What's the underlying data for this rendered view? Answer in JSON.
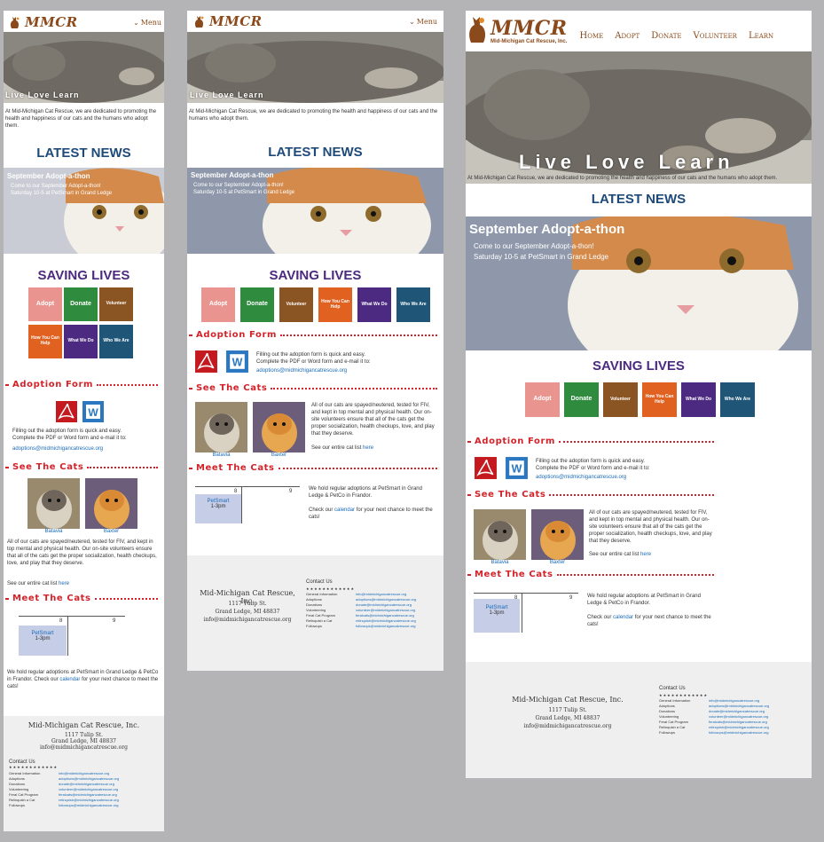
{
  "brand": {
    "logo_text": "MMCR",
    "logo_subtitle": "Mid-Michigan Cat Rescue, Inc.",
    "brown": "#8b4a1b"
  },
  "menu_label": "Menu",
  "nav": [
    "Home",
    "Adopt",
    "Donate",
    "Volunteer",
    "Learn"
  ],
  "hero_tagline": "Live Love Learn",
  "intro": "At Mid-Michigan Cat Rescue, we are dedicated to promoting the health and happiness of our cats and the humans who adopt them.",
  "latest_news": {
    "heading": "LATEST NEWS",
    "title": "September Adopt-a-thon",
    "body_line1": "Come to our September Adopt-a-thon!",
    "body_line2": "Saturday 10-5 at PetSmart in Grand Ledge"
  },
  "saving_lives": {
    "heading": "SAVING LIVES",
    "tiles": [
      {
        "label": "Adopt",
        "color": "#ea9490"
      },
      {
        "label": "Donate",
        "color": "#2f8b3e"
      },
      {
        "label": "Volunteer",
        "color": "#8b5423"
      },
      {
        "label": "How You Can Help",
        "color": "#e06120"
      },
      {
        "label": "What We Do",
        "color": "#4d2a82"
      },
      {
        "label": "Who We Are",
        "color": "#1f5678"
      }
    ]
  },
  "adoption_form": {
    "heading": "Adoption Form",
    "text_line1": "Filling out the adoption form is quick and easy.",
    "text_line2": "Complete the PDF or Word form and e-mail it to:",
    "email": "adoptions@midmichigancatrescue.org"
  },
  "see_cats": {
    "heading": "See The Cats",
    "cats": [
      {
        "name": "Batavia",
        "icon": "tabby-kitten-photo"
      },
      {
        "name": "Baxter",
        "icon": "orange-kitten-photo"
      }
    ],
    "text": "All of our cats are spayed/neutered, tested for FIV, and kept in top mental and physical health. Our on-site volunteers ensure that all of the cats get the proper socialization, health checkups, love, and play that they deserve.",
    "list_prefix": "See our entire cat list",
    "list_link": "here"
  },
  "meet_cats": {
    "heading": "Meet The Cats",
    "calendar": {
      "day1": "8",
      "day2": "9",
      "event": "PetSmart",
      "event_time": "1-3pm"
    },
    "text": "We hold regular adoptions at PetSmart in Grand Ledge & PetCo in Frandor.",
    "check_prefix": "Check our",
    "check_link": "calendar",
    "check_suffix": "for your next chance to meet the cats!"
  },
  "footer": {
    "org": "Mid-Michigan Cat Rescue, Inc.",
    "street": "1117 Tulip St.",
    "city": "Grand Ledge, MI 48837",
    "email": "info@midmichigancatrescue.org",
    "contact_heading": "Contact Us",
    "stars": "★★★★★★★★★★★★",
    "contacts": [
      {
        "label": "General Information",
        "email": "info@midmichigancatrescue.org"
      },
      {
        "label": "Adoptions",
        "email": "adoptions@midmichigancatrescue.org"
      },
      {
        "label": "Donations",
        "email": "donate@midmichigancatrescue.org"
      },
      {
        "label": "Volunteering",
        "email": "volunteer@midmichigancatrescue.org"
      },
      {
        "label": "Feral Cat Program",
        "email": "feralcats@midmichigancatrescue.org"
      },
      {
        "label": "Relinquish a Cat",
        "email": "relinquish@midmichigancatrescue.org"
      },
      {
        "label": "Followups",
        "email": "followups@midmichigancatrescue.org"
      }
    ]
  }
}
